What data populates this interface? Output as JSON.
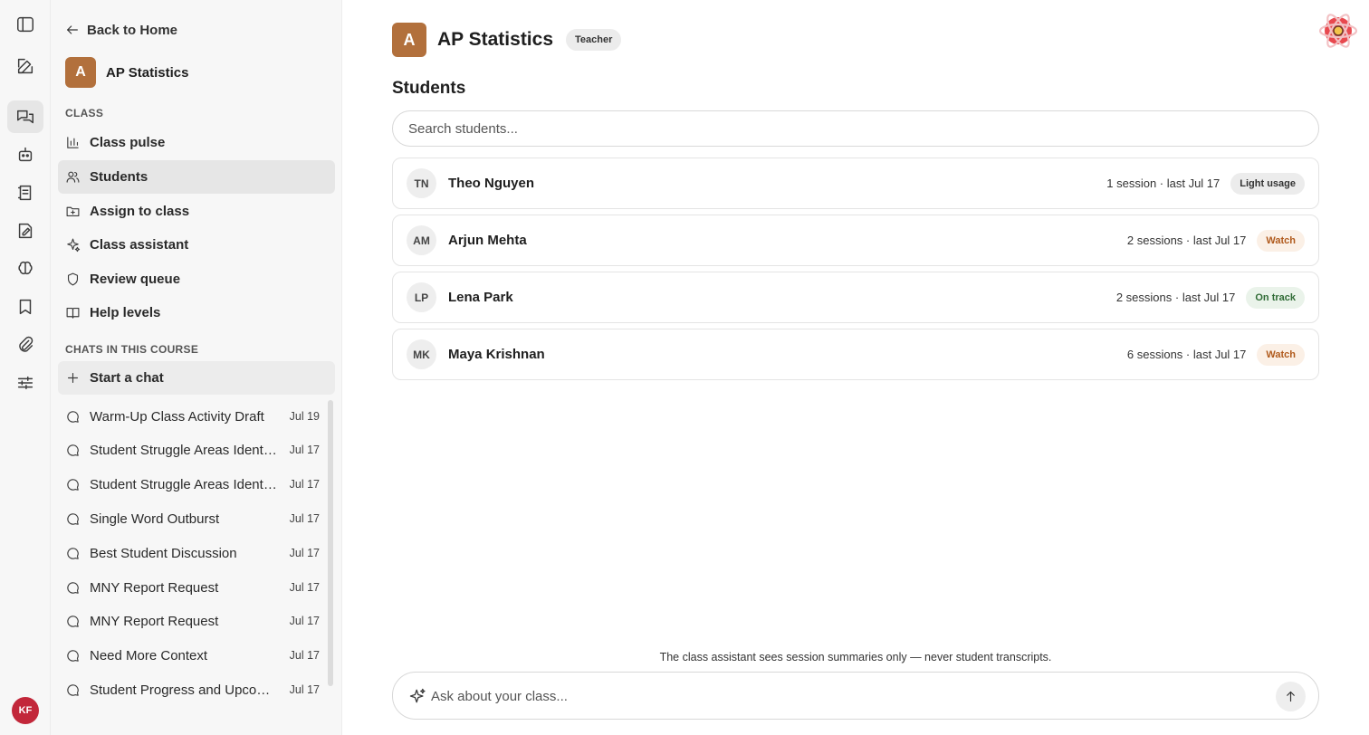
{
  "rail": {
    "icons": [
      "sidebar-toggle-icon",
      "compose-icon",
      "chats-icon",
      "robot-icon",
      "notebook-icon",
      "assignment-icon",
      "brain-icon",
      "bookmark-icon",
      "paperclip-icon",
      "sliders-icon"
    ],
    "active": "chats-icon",
    "user_initials": "KF"
  },
  "sidebar": {
    "back_label": "Back to Home",
    "course_initial": "A",
    "course_name": "AP Statistics",
    "class_section": "CLASS",
    "nav": [
      {
        "label": "Class pulse",
        "icon": "bar-chart-icon"
      },
      {
        "label": "Students",
        "icon": "users-icon",
        "active": true
      },
      {
        "label": "Assign to class",
        "icon": "folder-plus-icon"
      },
      {
        "label": "Class assistant",
        "icon": "sparkle-icon"
      },
      {
        "label": "Review queue",
        "icon": "shield-icon"
      },
      {
        "label": "Help levels",
        "icon": "book-icon"
      }
    ],
    "chats_section": "CHATS IN THIS COURSE",
    "start_chat_label": "Start a chat",
    "chats": [
      {
        "title": "Warm-Up Class Activity Draft",
        "date": "Jul 19"
      },
      {
        "title": "Student Struggle Areas Identification",
        "date": "Jul 17"
      },
      {
        "title": "Student Struggle Areas Identification",
        "date": "Jul 17"
      },
      {
        "title": "Single Word Outburst",
        "date": "Jul 17"
      },
      {
        "title": "Best Student Discussion",
        "date": "Jul 17"
      },
      {
        "title": "MNY Report Request",
        "date": "Jul 17"
      },
      {
        "title": "MNY Report Request",
        "date": "Jul 17"
      },
      {
        "title": "Need More Context",
        "date": "Jul 17"
      },
      {
        "title": "Student Progress and Upcoming Plans",
        "date": "Jul 17"
      }
    ]
  },
  "main": {
    "course_initial": "A",
    "title": "AP Statistics",
    "role": "Teacher",
    "students_heading": "Students",
    "search_placeholder": "Search students...",
    "students": [
      {
        "initials": "TN",
        "name": "Theo Nguyen",
        "meta": "1 session · last Jul 17",
        "status": "Light usage",
        "status_type": "light"
      },
      {
        "initials": "AM",
        "name": "Arjun Mehta",
        "meta": "2 sessions · last Jul 17",
        "status": "Watch",
        "status_type": "watch"
      },
      {
        "initials": "LP",
        "name": "Lena Park",
        "meta": "2 sessions · last Jul 17",
        "status": "On track",
        "status_type": "ontrack"
      },
      {
        "initials": "MK",
        "name": "Maya Krishnan",
        "meta": "6 sessions · last Jul 17",
        "status": "Watch",
        "status_type": "watch"
      }
    ],
    "notice": "The class assistant sees session summaries only — never student transcripts.",
    "composer_placeholder": "Ask about your class..."
  },
  "colors": {
    "course_badge": "#b2703c",
    "user_avatar": "#c2273a",
    "watch_text": "#b05a1c",
    "ontrack_text": "#2f6b35"
  }
}
